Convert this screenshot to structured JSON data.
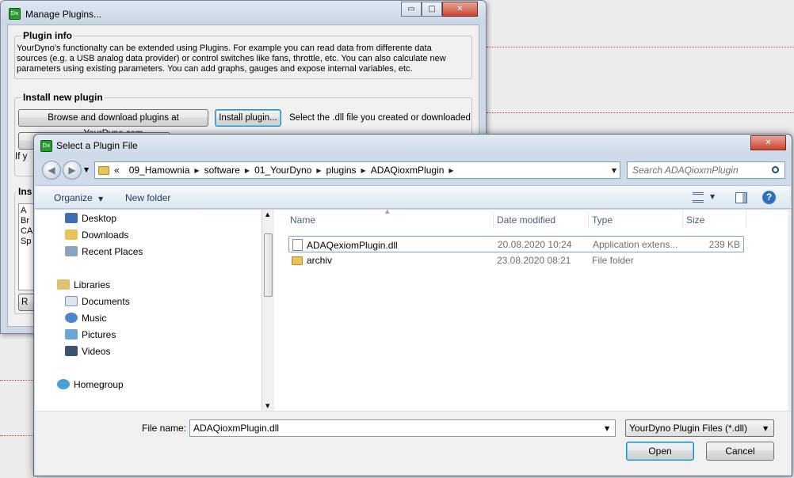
{
  "bg_dialog": {
    "title": "Manage Plugins...",
    "caption_buttons": {
      "minimize": "▭",
      "maximize": "□",
      "close": "✕"
    },
    "plugin_info": {
      "label": "Plugin info",
      "lines": [
        "YourDyno's functionalty can be extended using Plugins.  For example you can read data from differente data",
        "sources (e.g. a USB analog data provider) or control switches like fans, throttle, etc. You can also calculate new",
        "parameters using existing parameters. You can add graphs, gauges and expose internal variables, etc."
      ]
    },
    "install": {
      "label": "Install new plugin",
      "browse_button": "Browse and download plugins at YourDyno.com",
      "install_button": "Install plugin...",
      "hint": "Select the .dll file you created or downloaded",
      "partial_text": "If y"
    },
    "installed": {
      "label_partial": "Ins",
      "items_partial": [
        "A",
        "Br",
        "CA",
        "Sp"
      ],
      "button_partial": "R"
    }
  },
  "fg_dialog": {
    "title": "Select a Plugin File",
    "close_label": "✕",
    "breadcrumbs": [
      "09_Hamownia",
      "software",
      "01_YourDyno",
      "plugins",
      "ADAQioxmPlugin"
    ],
    "breadcrumb_prefix": "«",
    "search_placeholder": "Search ADAQioxmPlugin",
    "toolbar": {
      "organize": "Organize",
      "new_folder": "New folder"
    },
    "nav_items": [
      {
        "label": "Desktop",
        "icon": "desktop-icon"
      },
      {
        "label": "Downloads",
        "icon": "downloads-icon"
      },
      {
        "label": "Recent Places",
        "icon": "recent-places-icon"
      },
      {
        "label": "Libraries",
        "icon": "libraries-icon"
      },
      {
        "label": "Documents",
        "icon": "documents-icon"
      },
      {
        "label": "Music",
        "icon": "music-icon"
      },
      {
        "label": "Pictures",
        "icon": "pictures-icon"
      },
      {
        "label": "Videos",
        "icon": "videos-icon"
      },
      {
        "label": "Homegroup",
        "icon": "homegroup-icon"
      }
    ],
    "columns": {
      "name": "Name",
      "date": "Date modified",
      "type": "Type",
      "size": "Size"
    },
    "files": [
      {
        "name": "ADAQexiomPlugin.dll",
        "date": "20.08.2020 10:24",
        "type": "Application extens...",
        "size": "239 KB",
        "selected": true
      },
      {
        "name": "archiv",
        "date": "23.08.2020 08:21",
        "type": "File folder",
        "size": "",
        "selected": false
      }
    ],
    "file_name_label": "File name:",
    "file_name_value": "ADAQioxmPlugin.dll",
    "file_type": "YourDyno Plugin Files (*.dll)",
    "open_button": "Open",
    "cancel_button": "Cancel"
  }
}
